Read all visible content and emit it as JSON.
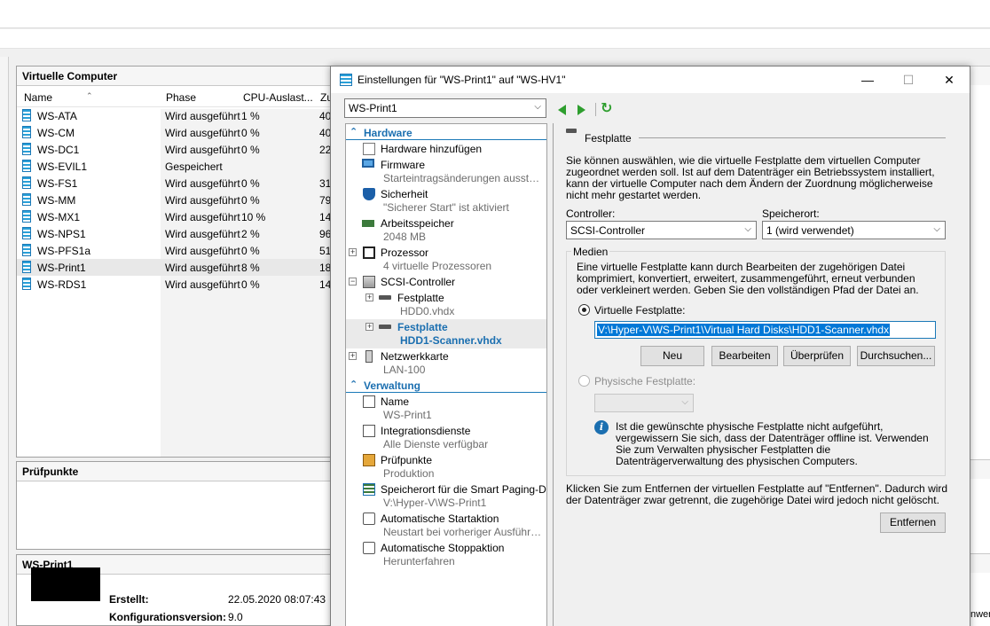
{
  "manager": {
    "vm_panel_title": "Virtuelle Computer",
    "columns": {
      "name": "Name",
      "phase": "Phase",
      "cpu": "CPU-Auslast...",
      "zu": "Zu"
    },
    "vms": [
      {
        "name": "WS-ATA",
        "phase": "Wird ausgeführt",
        "cpu": "1 %",
        "mem": "40"
      },
      {
        "name": "WS-CM",
        "phase": "Wird ausgeführt",
        "cpu": "0 %",
        "mem": "40"
      },
      {
        "name": "WS-DC1",
        "phase": "Wird ausgeführt",
        "cpu": "0 %",
        "mem": "22"
      },
      {
        "name": "WS-EVIL1",
        "phase": "Gespeichert",
        "cpu": "",
        "mem": ""
      },
      {
        "name": "WS-FS1",
        "phase": "Wird ausgeführt",
        "cpu": "0 %",
        "mem": "31"
      },
      {
        "name": "WS-MM",
        "phase": "Wird ausgeführt",
        "cpu": "0 %",
        "mem": "79"
      },
      {
        "name": "WS-MX1",
        "phase": "Wird ausgeführt",
        "cpu": "10 %",
        "mem": "14"
      },
      {
        "name": "WS-NPS1",
        "phase": "Wird ausgeführt",
        "cpu": "2 %",
        "mem": "96"
      },
      {
        "name": "WS-PFS1a",
        "phase": "Wird ausgeführt",
        "cpu": "0 %",
        "mem": "51"
      },
      {
        "name": "WS-Print1",
        "phase": "Wird ausgeführt",
        "cpu": "8 %",
        "mem": "18"
      },
      {
        "name": "WS-RDS1",
        "phase": "Wird ausgeführt",
        "cpu": "0 %",
        "mem": "14"
      }
    ],
    "checkpoints_title": "Prüfpunkte",
    "detail_title": "WS-Print1",
    "created_label": "Erstellt:",
    "created_value": "22.05.2020 08:07:43",
    "config_label": "Konfigurationsversion:",
    "config_value": "9.0",
    "right_fragment": "nwer"
  },
  "dialog": {
    "title": "Einstellungen für \"WS-Print1\" auf \"WS-HV1\"",
    "window_buttons": {
      "minimize": "—",
      "maximize": "☐",
      "close": "✕"
    },
    "vm_select": "WS-Print1",
    "tree": {
      "hardware_header": "Hardware",
      "management_header": "Verwaltung",
      "items": {
        "add_hw": {
          "l1": "Hardware hinzufügen"
        },
        "firmware": {
          "l1": "Firmware",
          "l2": "Starteintragsänderungen ausstehen"
        },
        "security": {
          "l1": "Sicherheit",
          "l2": "\"Sicherer Start\" ist aktiviert"
        },
        "memory": {
          "l1": "Arbeitsspeicher",
          "l2": "2048 MB"
        },
        "cpu": {
          "l1": "Prozessor",
          "l2": "4 virtuelle Prozessoren"
        },
        "scsi": {
          "l1": "SCSI-Controller"
        },
        "disk0": {
          "l1": "Festplatte",
          "l2": "HDD0.vhdx"
        },
        "disk1": {
          "l1": "Festplatte",
          "l2": "HDD1-Scanner.vhdx"
        },
        "nic": {
          "l1": "Netzwerkkarte",
          "l2": "LAN-100"
        },
        "name": {
          "l1": "Name",
          "l2": "WS-Print1"
        },
        "integration": {
          "l1": "Integrationsdienste",
          "l2": "Alle Dienste verfügbar"
        },
        "checkpoints": {
          "l1": "Prüfpunkte",
          "l2": "Produktion"
        },
        "smart_paging": {
          "l1": "Speicherort für die Smart Paging-D...",
          "l2": "V:\\Hyper-V\\WS-Print1"
        },
        "auto_start": {
          "l1": "Automatische Startaktion",
          "l2": "Neustart bei vorheriger Ausführung"
        },
        "auto_stop": {
          "l1": "Automatische Stoppaktion",
          "l2": "Herunterfahren"
        }
      }
    },
    "content": {
      "section_title": "Festplatte",
      "intro": "Sie können auswählen, wie die virtuelle Festplatte dem virtuellen Computer zugeordnet werden soll. Ist auf dem Datenträger ein Betriebssystem installiert, kann der virtuelle Computer nach dem Ändern der Zuordnung möglicherweise nicht mehr gestartet werden.",
      "controller_label": "Controller:",
      "controller_value": "SCSI-Controller",
      "location_label": "Speicherort:",
      "location_value": "1 (wird verwendet)",
      "media_label": "Medien",
      "media_desc": "Eine virtuelle Festplatte kann durch Bearbeiten der zugehörigen Datei komprimiert, konvertiert, erweitert, zusammengeführt, erneut verbunden oder verkleinert werden. Geben Sie den vollständigen Pfad der Datei an.",
      "virtual_disk_label": "Virtuelle Festplatte:",
      "virtual_disk_path": "V:\\Hyper-V\\WS-Print1\\Virtual Hard Disks\\HDD1-Scanner.vhdx",
      "buttons": {
        "new": "Neu",
        "edit": "Bearbeiten",
        "inspect": "Überprüfen",
        "browse": "Durchsuchen..."
      },
      "physical_disk_label": "Physische Festplatte:",
      "info_text": "Ist die gewünschte physische Festplatte nicht aufgeführt, vergewissern Sie sich, dass der Datenträger offline ist. Verwenden Sie zum Verwalten physischer Festplatten die Datenträgerverwaltung des physischen Computers.",
      "remove_desc": "Klicken Sie zum Entfernen der virtuellen Festplatte auf \"Entfernen\". Dadurch wird der Datenträger zwar getrennt, die zugehörige Datei wird jedoch nicht gelöscht.",
      "remove_button": "Entfernen"
    }
  }
}
